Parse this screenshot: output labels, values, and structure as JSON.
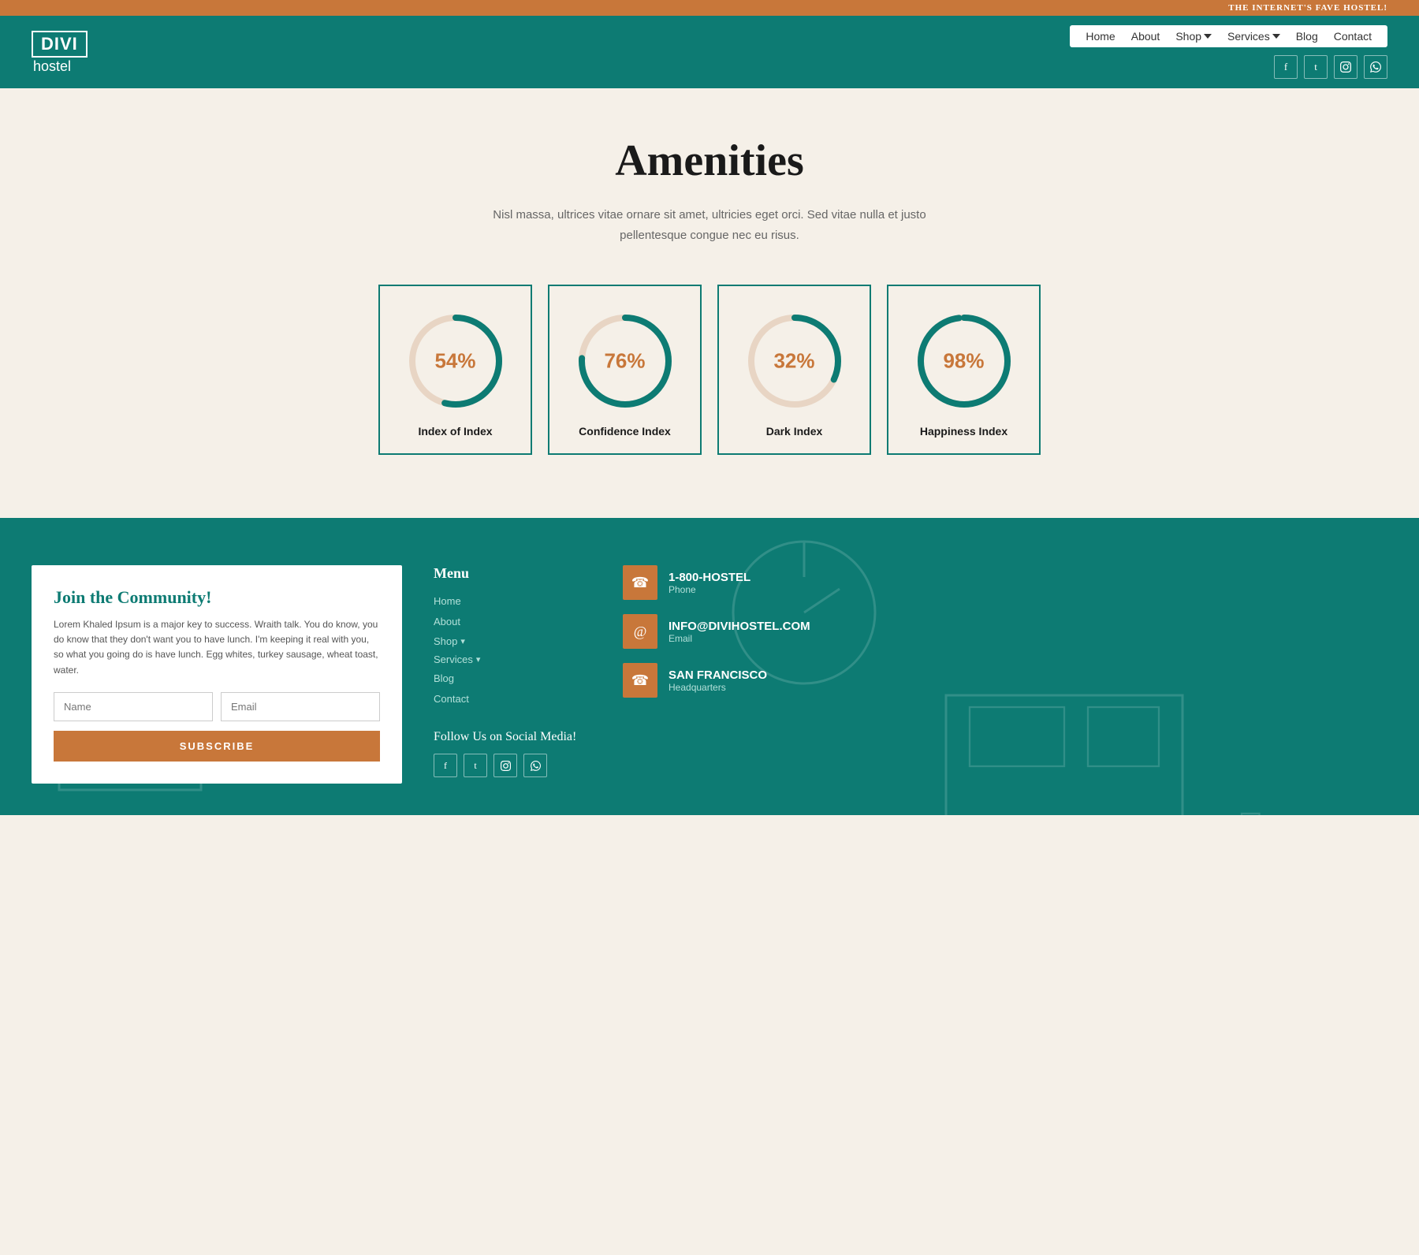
{
  "topbar": {
    "text": "THE INTERNET'S FAVE HOSTEL!"
  },
  "header": {
    "logo_divi": "DIVI",
    "logo_hostel": "hostel",
    "nav": {
      "home": "Home",
      "about": "About",
      "shop": "Shop",
      "services": "Services",
      "blog": "Blog",
      "contact": "Contact"
    },
    "social": [
      "f",
      "t",
      "📷",
      "💬"
    ]
  },
  "main": {
    "title": "Amenities",
    "subtitle": "Nisl massa, ultrices vitae ornare sit amet, ultricies eget orci. Sed vitae nulla et justo pellentesque congue nec eu risus.",
    "stats": [
      {
        "id": "stat1",
        "value": 54,
        "label": "Index of Index"
      },
      {
        "id": "stat2",
        "value": 76,
        "label": "Confidence Index"
      },
      {
        "id": "stat3",
        "value": 32,
        "label": "Dark Index"
      },
      {
        "id": "stat4",
        "value": 98,
        "label": "Happiness Index"
      }
    ]
  },
  "footer": {
    "form": {
      "title": "Join the Community!",
      "desc": "Lorem Khaled Ipsum is a major key to success. Wraith talk. You do know, you do know that they don't want you to have lunch. I'm keeping it real with you, so what you going do is have lunch. Egg whites, turkey sausage, wheat toast, water.",
      "name_placeholder": "Name",
      "email_placeholder": "Email",
      "subscribe_label": "SUBSCRIBE"
    },
    "menu": {
      "title": "Menu",
      "items": [
        {
          "label": "Home"
        },
        {
          "label": "About"
        },
        {
          "label": "Shop",
          "has_arrow": true
        },
        {
          "label": "Services",
          "has_arrow": true
        },
        {
          "label": "Blog"
        },
        {
          "label": "Contact"
        }
      ]
    },
    "social_title": "Follow Us on Social Media!",
    "contact": [
      {
        "icon": "☎",
        "value": "1-800-HOSTEL",
        "label": "Phone"
      },
      {
        "icon": "@",
        "value": "INFO@DIVIHOSTEL.COM",
        "label": "Email"
      },
      {
        "icon": "☎",
        "value": "SAN FRANCISCO",
        "label": "Headquarters"
      }
    ]
  }
}
